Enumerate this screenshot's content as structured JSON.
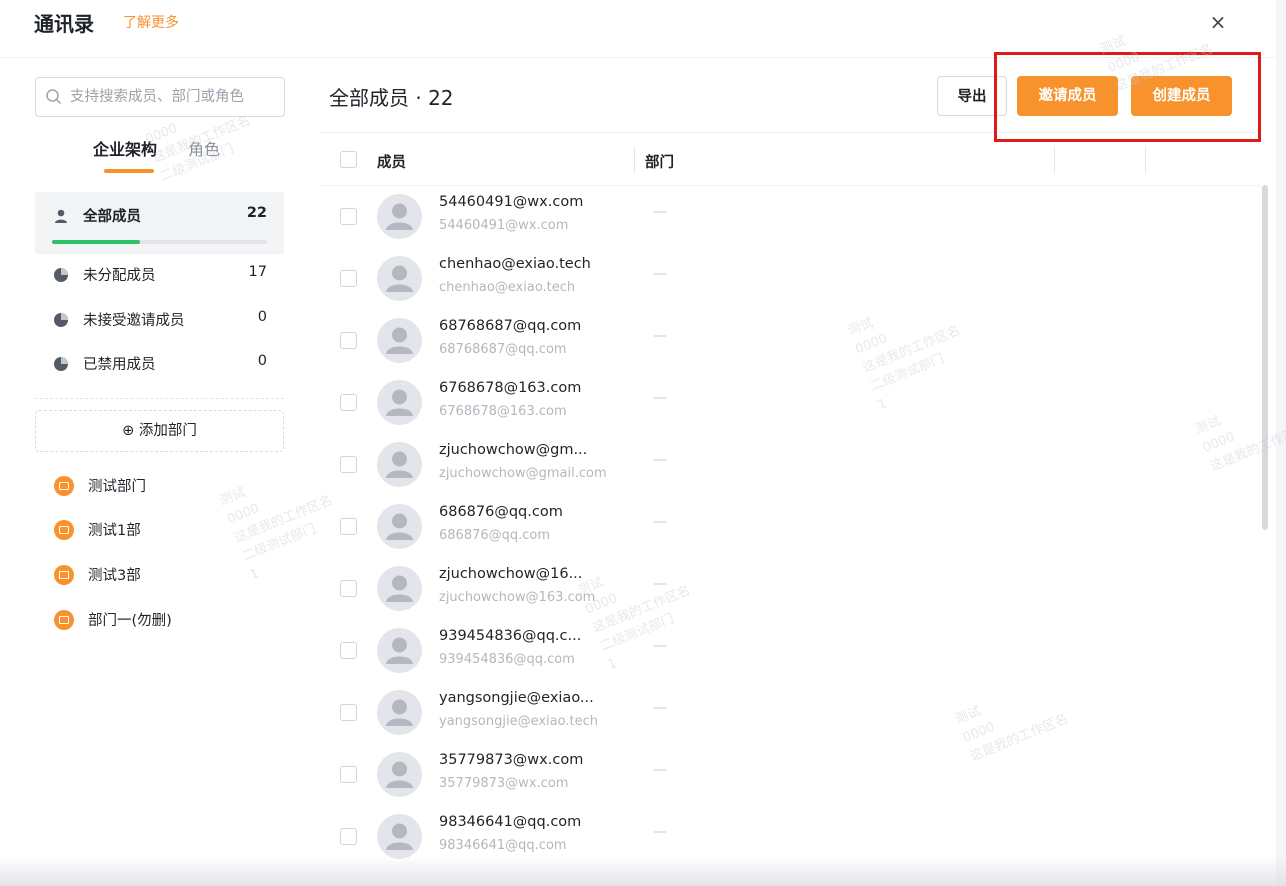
{
  "header": {
    "title": "通讯录",
    "learn_more": "了解更多",
    "close": "×"
  },
  "sidebar": {
    "search_placeholder": "支持搜索成员、部门或角色",
    "tabs": [
      "企业架构",
      "角色"
    ],
    "all_members": {
      "label": "全部成员",
      "count": "22",
      "progress": 0.41
    },
    "stats": [
      {
        "label": "未分配成员",
        "count": "17"
      },
      {
        "label": "未接受邀请成员",
        "count": "0"
      },
      {
        "label": "已禁用成员",
        "count": "0"
      }
    ],
    "add_department": "⊕ 添加部门",
    "departments": [
      "测试部门",
      "测试1部",
      "测试3部",
      "部门一(勿删)"
    ]
  },
  "main": {
    "title": "全部成员 · 22",
    "export_label": "导出",
    "invite_label": "邀请成员",
    "create_label": "创建成员",
    "columns": {
      "member": "成员",
      "department": "部门"
    },
    "members": [
      {
        "name": "54460491@wx.com",
        "email": "54460491@wx.com",
        "dept": "—"
      },
      {
        "name": "chenhao@exiao.tech",
        "email": "chenhao@exiao.tech",
        "dept": "—"
      },
      {
        "name": "68768687@qq.com",
        "email": "68768687@qq.com",
        "dept": "—"
      },
      {
        "name": "6768678@163.com",
        "email": "6768678@163.com",
        "dept": "—"
      },
      {
        "name": "zjuchowchow@gm...",
        "email": "zjuchowchow@gmail.com",
        "dept": "—"
      },
      {
        "name": "686876@qq.com",
        "email": "686876@qq.com",
        "dept": "—"
      },
      {
        "name": "zjuchowchow@16...",
        "email": "zjuchowchow@163.com",
        "dept": "—"
      },
      {
        "name": "939454836@qq.c...",
        "email": "939454836@qq.com",
        "dept": "—"
      },
      {
        "name": "yangsongjie@exiao...",
        "email": "yangsongjie@exiao.tech",
        "dept": "—"
      },
      {
        "name": "35779873@wx.com",
        "email": "35779873@wx.com",
        "dept": "—"
      },
      {
        "name": "98346641@qq.com",
        "email": "98346641@qq.com",
        "dept": "—"
      }
    ]
  },
  "watermark": [
    "测试",
    "0000",
    "这是我的工作区名",
    "二级测试部门",
    "1"
  ],
  "colors": {
    "accent": "#f7922d",
    "progress": "#2ec166",
    "highlight": "#e01818"
  }
}
